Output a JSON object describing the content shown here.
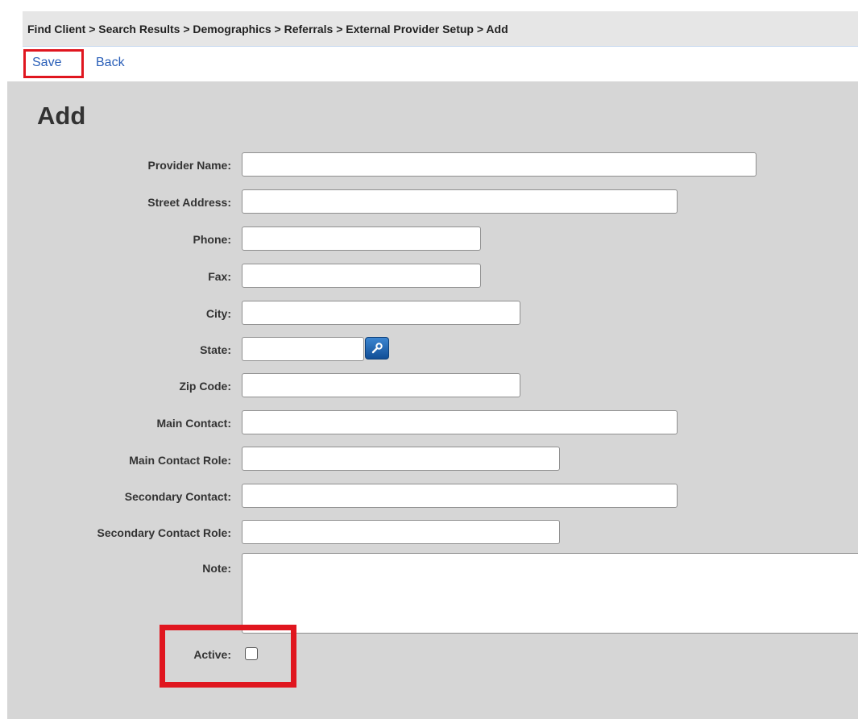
{
  "breadcrumb": "Find Client > Search Results > Demographics > Referrals > External Provider Setup > Add",
  "toolbar": {
    "save_label": "Save",
    "back_label": "Back"
  },
  "page": {
    "title": "Add"
  },
  "fields": {
    "provider_name": {
      "label": "Provider Name:",
      "value": ""
    },
    "street_address": {
      "label": "Street Address:",
      "value": ""
    },
    "phone": {
      "label": "Phone:",
      "value": ""
    },
    "fax": {
      "label": "Fax:",
      "value": ""
    },
    "city": {
      "label": "City:",
      "value": ""
    },
    "state": {
      "label": "State:",
      "value": ""
    },
    "zip_code": {
      "label": "Zip Code:",
      "value": ""
    },
    "main_contact": {
      "label": "Main Contact:",
      "value": ""
    },
    "main_contact_role": {
      "label": "Main Contact Role:",
      "value": ""
    },
    "secondary_contact": {
      "label": "Secondary Contact:",
      "value": ""
    },
    "secondary_contact_role": {
      "label": "Secondary Contact Role:",
      "value": ""
    },
    "note": {
      "label": "Note:",
      "value": ""
    },
    "active": {
      "label": "Active:",
      "checked": false
    }
  },
  "icons": {
    "state_lookup": "search-icon"
  },
  "colors": {
    "highlight": "#e0161f",
    "link": "#2a5fb8",
    "content_bg": "#d6d6d6",
    "breadcrumb_bg": "#e6e6e6",
    "lookup_button": "#1f63b0"
  }
}
